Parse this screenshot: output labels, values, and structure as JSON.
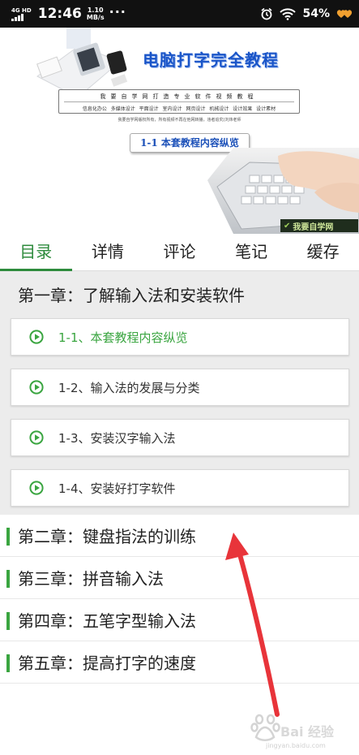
{
  "status_bar": {
    "network": "4G HD",
    "time": "12:46",
    "speed_value": "1.10",
    "speed_unit": "MB/s",
    "more": "···",
    "battery": "54%"
  },
  "banner": {
    "title": "电脑打字完全教程",
    "box_row1": "我要自学网打造专业软件视频教程",
    "box_row2": "信息化办公  多媒体设计  平面设计  室内设计  网页设计  机械设计  设计效果  设计素材",
    "note": "我要自学网版权所有，所有视频不再在他网转播，违者追究(刘炜老师",
    "lesson_label": "1-1  本套教程内容纵览",
    "logo_text": "我要自学网"
  },
  "tabs": [
    {
      "label": "目录",
      "active": true
    },
    {
      "label": "详情",
      "active": false
    },
    {
      "label": "评论",
      "active": false
    },
    {
      "label": "笔记",
      "active": false
    },
    {
      "label": "缓存",
      "active": false
    }
  ],
  "chapters": [
    {
      "title": "第一章：了解输入法和安装软件",
      "lessons": [
        {
          "label": "1-1、本套教程内容纵览",
          "current": true
        },
        {
          "label": "1-2、输入法的发展与分类",
          "current": false
        },
        {
          "label": "1-3、安装汉字输入法",
          "current": false
        },
        {
          "label": "1-4、安装好打字软件",
          "current": false
        }
      ]
    },
    {
      "title": "第二章：键盘指法的训练"
    },
    {
      "title": "第三章：拼音输入法"
    },
    {
      "title": "第四章：五笔字型输入法"
    },
    {
      "title": "第五章：提高打字的速度"
    }
  ],
  "watermark": {
    "text": "Bai 经验",
    "sub": "jingyan.baidu.com"
  },
  "colors": {
    "accent": "#2e8b3d",
    "current_lesson": "#3aa540",
    "arrow": "#e8343a",
    "banner_title": "#1a55c8"
  },
  "icons": {
    "play": "play-circle-icon",
    "alarm": "alarm-icon",
    "wifi": "wifi-icon",
    "battery": "battery-heart-icon"
  }
}
